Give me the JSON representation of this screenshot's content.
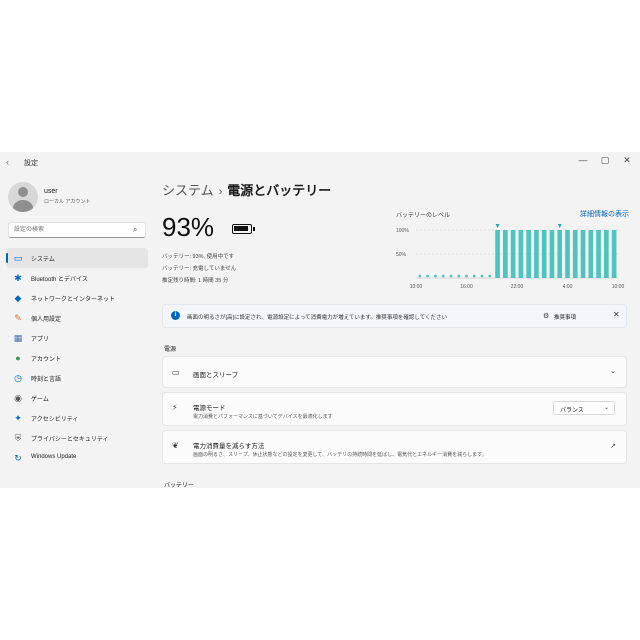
{
  "window": {
    "title": "設定",
    "back": "‹",
    "controls": [
      "—",
      "▢",
      "✕"
    ]
  },
  "profile": {
    "name": "user",
    "account": "ローカル アカウント"
  },
  "search": {
    "placeholder": "設定の検索"
  },
  "nav": [
    {
      "label": "システム",
      "icon": "system-icon",
      "color": "#0067c0"
    },
    {
      "label": "Bluetooth とデバイス",
      "icon": "bluetooth-icon",
      "color": "#0067c0"
    },
    {
      "label": "ネットワークとインターネット",
      "icon": "network-icon",
      "color": "#0067c0"
    },
    {
      "label": "個人用設定",
      "icon": "brush-icon",
      "color": "#d4722c"
    },
    {
      "label": "アプリ",
      "icon": "apps-icon",
      "color": "#4a6fa5"
    },
    {
      "label": "アカウント",
      "icon": "accounts-icon",
      "color": "#2d9c5a"
    },
    {
      "label": "時刻と言語",
      "icon": "time-language-icon",
      "color": "#0067c0"
    },
    {
      "label": "ゲーム",
      "icon": "gaming-icon",
      "color": "#555555"
    },
    {
      "label": "アクセシビリティ",
      "icon": "accessibility-icon",
      "color": "#0067c0"
    },
    {
      "label": "プライバシーとセキュリティ",
      "icon": "shield-icon",
      "color": "#666666"
    },
    {
      "label": "Windows Update",
      "icon": "windows-update-icon",
      "color": "#0067c0"
    }
  ],
  "breadcrumb": {
    "parent": "システム",
    "separator": "›",
    "current": "電源とバッテリー"
  },
  "battery": {
    "percent": "93%",
    "level": 0.93,
    "stats": [
      "バッテリー: 93%, 使用中です",
      "バッテリー: 充電していません",
      "推定残り時間: 1 時間 35 分"
    ]
  },
  "chart_title": "バッテリーのレベル",
  "chart_link": "詳細情報の表示",
  "chart_data": {
    "type": "bar",
    "y_ticks": [
      "100%",
      "50%"
    ],
    "x_ticks": [
      "10:00",
      "16:00",
      "22:00",
      "4:00",
      "10:00"
    ],
    "values": [
      0,
      0,
      0,
      0,
      0,
      0,
      0,
      0,
      0,
      0,
      100,
      100,
      100,
      100,
      100,
      100,
      100,
      100,
      100,
      100,
      100,
      100,
      100,
      100,
      100,
      100
    ],
    "ylim": [
      0,
      100
    ],
    "color": "#4fc3c0"
  },
  "info": {
    "text": "画面の明るさが[高]に設定され、電源設定によって消費電力が増えています。推奨事項を確認してください",
    "action": "推奨事項",
    "close": "✕"
  },
  "sections": {
    "power": "電源",
    "battery": "バッテリー"
  },
  "cards": [
    {
      "title": "画面とスリープ",
      "sub": "",
      "icon": "screen-sleep-icon",
      "chevron": "⌄"
    },
    {
      "title": "電源モード",
      "sub": "電力消費とパフォーマンスに基づいてデバイスを最適化します",
      "icon": "power-mode-icon",
      "dropdown": "バランス",
      "chevron": "⌄"
    },
    {
      "title": "電力消費量を減らす方法",
      "sub": "画面の明るさ、スリープ、休止状態などの設定を変更して、バッテリの持続時間を延ばし、電気代とエネルギー消費を減らします。",
      "icon": "leaf-icon",
      "chevron": "↗"
    }
  ]
}
